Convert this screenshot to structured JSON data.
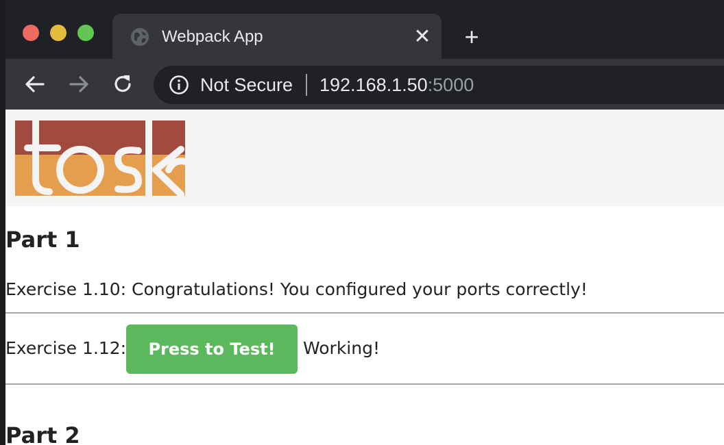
{
  "browser": {
    "tab": {
      "title": "Webpack App",
      "close_glyph": "✕",
      "favicon": "globe-icon"
    },
    "new_tab_glyph": "+",
    "nav": {
      "back": "arrow-left-icon",
      "forward": "arrow-right-icon",
      "reload": "reload-icon"
    },
    "address_bar": {
      "security_icon": "info-icon",
      "security_label": "Not Secure",
      "host": "192.168.1.50",
      "port": ":5000"
    },
    "colors": {
      "traffic_close": "#ec6a5e",
      "traffic_minimize": "#e3bc3f",
      "traffic_zoom": "#61c454"
    }
  },
  "page": {
    "logo": {
      "alt": "toska",
      "colors": {
        "top": "#a14a3e",
        "bottom": "#e59e4e"
      }
    },
    "part1": {
      "heading": "Part 1",
      "exercise_110": "Exercise 1.10: Congratulations! You configured your ports correctly!",
      "exercise_112_label": "Exercise 1.12:",
      "test_button": "Press to Test!",
      "test_result": "Working!"
    },
    "part2": {
      "heading": "Part 2"
    },
    "colors": {
      "button": "#5cb85c"
    }
  }
}
